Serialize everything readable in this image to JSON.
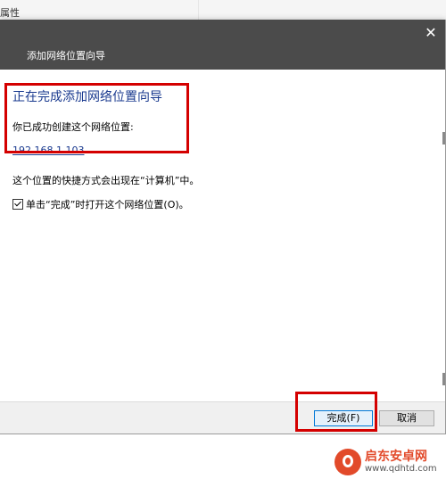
{
  "background_app": {
    "partial_label": "属性"
  },
  "dialog": {
    "close_glyph": "✕",
    "wizard_caption": "添加网络位置向导",
    "heading": "正在完成添加网络位置向导",
    "created_label": "你已成功创建这个网络位置:",
    "location": "192.168.1.103",
    "shortcut_note": "这个位置的快捷方式会出现在“计算机”中。",
    "open_checkbox": {
      "label": "单击“完成”时打开这个网络位置(O)。",
      "checked": true
    },
    "buttons": {
      "finish": "完成(F)",
      "cancel": "取消"
    }
  },
  "watermark": {
    "title": "启东安卓网",
    "url": "www.qdhtd.com"
  },
  "colors": {
    "title_bar": "#4b4b4b",
    "heading": "#1a3a8f",
    "highlight": "#d40000",
    "primary_button_border": "#0078d7"
  }
}
